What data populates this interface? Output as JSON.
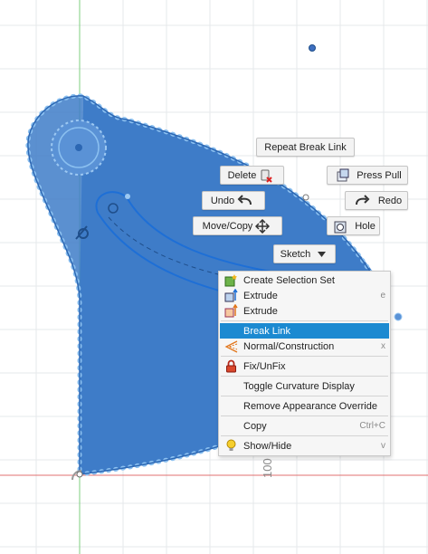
{
  "canvas": {
    "dimension_label": "100"
  },
  "marking_menu": {
    "repeat": "Repeat Break Link",
    "delete": "Delete",
    "press_pull": "Press Pull",
    "undo": "Undo",
    "redo": "Redo",
    "move_copy": "Move/Copy",
    "hole": "Hole",
    "sketch": "Sketch"
  },
  "context_menu": {
    "items": [
      {
        "label": "Create Selection Set",
        "shortcut": "",
        "icon": "selection-set-icon"
      },
      {
        "label": "Extrude",
        "shortcut": "e",
        "icon": "extrude-icon"
      },
      {
        "label": "Extrude",
        "shortcut": "",
        "icon": "extrude-orange-icon"
      },
      {
        "label": "Break Link",
        "shortcut": "",
        "icon": "",
        "highlighted": true
      },
      {
        "label": "Normal/Construction",
        "shortcut": "x",
        "icon": "construction-icon"
      },
      {
        "label": "Fix/UnFix",
        "shortcut": "",
        "icon": "lock-icon"
      },
      {
        "label": "Toggle Curvature Display",
        "shortcut": "",
        "icon": ""
      },
      {
        "label": "Remove Appearance Override",
        "shortcut": "",
        "icon": ""
      },
      {
        "label": "Copy",
        "shortcut": "Ctrl+C",
        "icon": ""
      },
      {
        "label": "Show/Hide",
        "shortcut": "v",
        "icon": "lightbulb-icon"
      }
    ]
  },
  "colors": {
    "profile_fill": "#3e7cc8",
    "profile_edge": "#8bc0f0",
    "highlight": "#1c8ad1",
    "grid": "#e3e6ea",
    "axis_green": "#7fcf7f",
    "axis_red": "#e07070"
  }
}
